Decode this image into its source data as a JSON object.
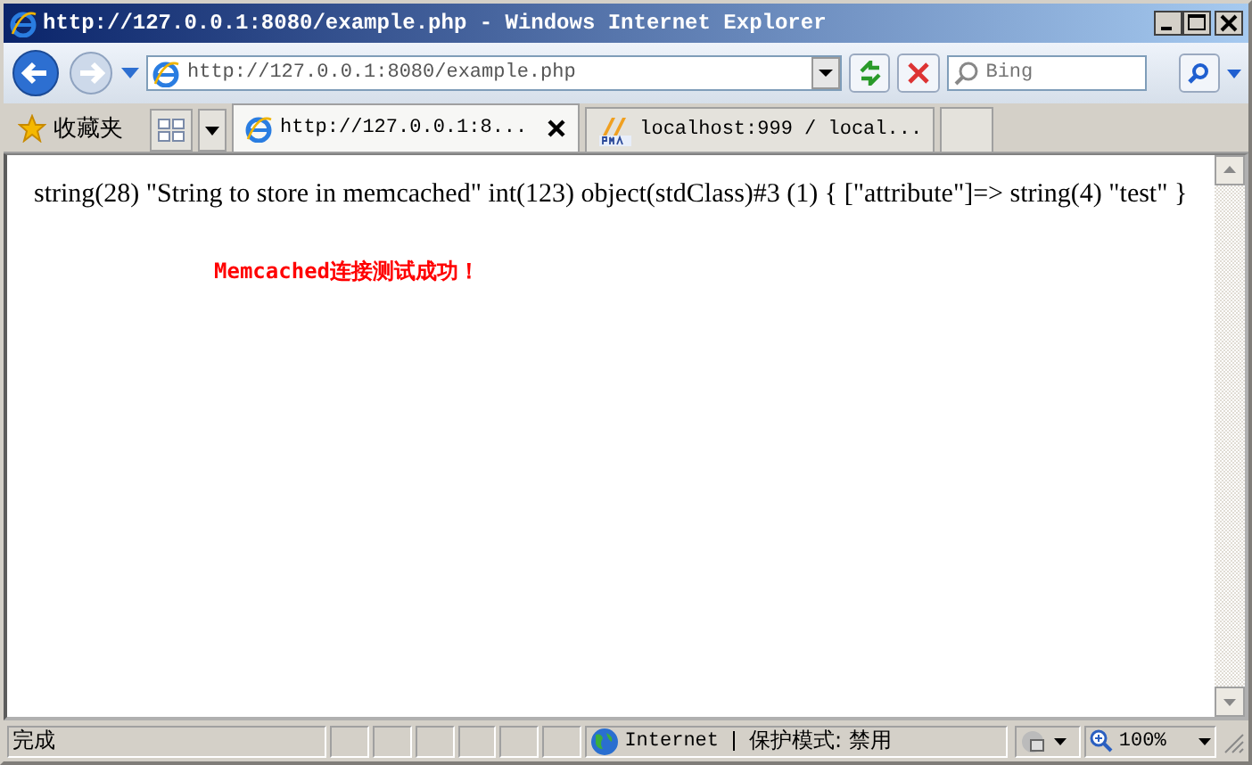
{
  "window": {
    "title": "http://127.0.0.1:8080/example.php - Windows Internet Explorer"
  },
  "address_bar": {
    "value": "http://127.0.0.1:8080/example.php"
  },
  "search": {
    "placeholder": "Bing"
  },
  "favorites": {
    "label": "收藏夹"
  },
  "tabs": [
    {
      "label": "http://127.0.0.1:8...",
      "selected": true
    },
    {
      "label": "localhost:999 / local...",
      "selected": false
    }
  ],
  "content": {
    "output": "string(28) \"String to store in memcached\" int(123) object(stdClass)#3 (1) { [\"attribute\"]=> string(4) \"test\" }",
    "message": "Memcached连接测试成功！"
  },
  "status_bar": {
    "text": "完成",
    "zone": "Internet",
    "protected_mode": "保护模式: 禁用",
    "zoom": "100%"
  }
}
